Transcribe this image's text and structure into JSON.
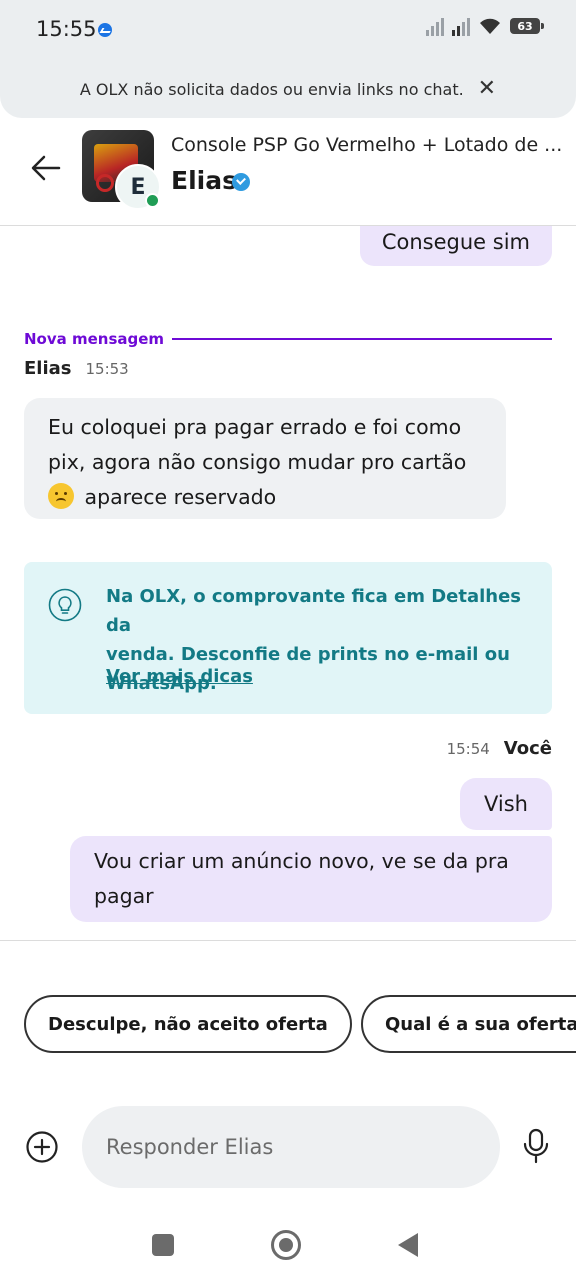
{
  "status_bar": {
    "time": "15:55",
    "battery": "63",
    "icons": [
      "messenger-icon",
      "signal-off-icon",
      "signal-icon",
      "wifi-icon",
      "battery-icon"
    ]
  },
  "notice": {
    "text": "A OLX não solicita dados ou envia links no chat.",
    "close_icon": "close-icon"
  },
  "header": {
    "listing_title": "Console PSP Go Vermelho + Lotado de ...",
    "contact_name": "Elias",
    "avatar_initial": "E",
    "verified": true,
    "online": true
  },
  "messages": {
    "previous_outgoing": "Consegue sim",
    "new_message_divider": "Nova mensagem",
    "incoming": {
      "sender": "Elias",
      "time": "15:53",
      "line1": "Eu coloquei pra pagar errado e foi como",
      "line2": "pix, agora não consigo mudar pro cartão",
      "line3": "aparece reservado"
    },
    "outgoing": {
      "sender": "Você",
      "time": "15:54",
      "message1": "Vish",
      "message2_line1": "Vou criar um anúncio novo, ve se da pra",
      "message2_line2": "pagar"
    }
  },
  "tip": {
    "line1": "Na OLX, o comprovante fica em Detalhes da",
    "line2": "venda. Desconfie de prints no e-mail ou",
    "line3": "WhatsApp.",
    "link": "Ver mais dicas"
  },
  "quick_replies": [
    "Desculpe, não aceito oferta",
    "Qual é a sua oferta?"
  ],
  "composer": {
    "placeholder": "Responder Elias"
  },
  "colors": {
    "accent_purple": "#6e0ad6",
    "outgoing_bubble": "#ece4fb",
    "incoming_bubble": "#eff1f3",
    "tip_background": "#e1f5f7",
    "tip_text": "#137a85",
    "online_green": "#1f9d55",
    "verified_blue": "#2f9be0"
  }
}
